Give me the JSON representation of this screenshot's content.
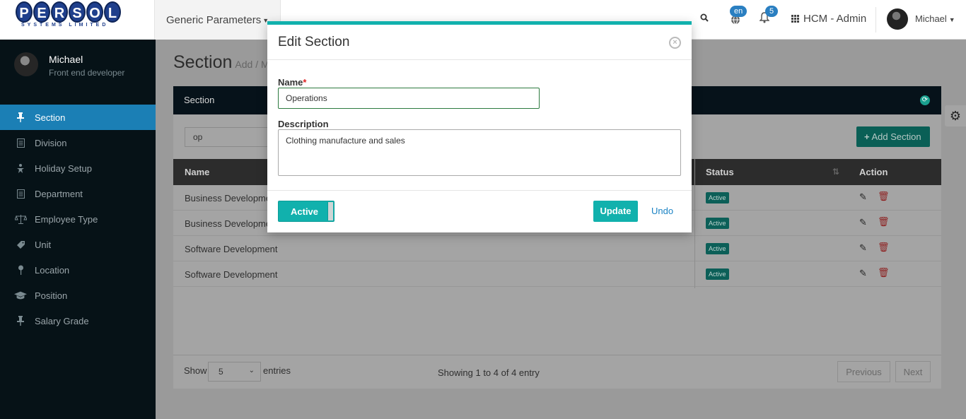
{
  "header": {
    "logo_text": "PERSOL",
    "logo_subtext": "SYSTEMS LIMITED",
    "menu_label": "Generic Parameters",
    "lang_badge": "en",
    "notif_count": "5",
    "app_label": "HCM - Admin",
    "user_name": "Michael"
  },
  "sidebar": {
    "user_name": "Michael",
    "user_role": "Front end developer",
    "items": [
      {
        "label": "Section",
        "icon": "pin-icon"
      },
      {
        "label": "Division",
        "icon": "document-icon"
      },
      {
        "label": "Holiday Setup",
        "icon": "person-icon"
      },
      {
        "label": "Department",
        "icon": "document-icon"
      },
      {
        "label": "Employee Type",
        "icon": "scale-icon"
      },
      {
        "label": "Unit",
        "icon": "tag-icon"
      },
      {
        "label": "Location",
        "icon": "map-pin-icon"
      },
      {
        "label": "Position",
        "icon": "graduation-cap-icon"
      },
      {
        "label": "Salary Grade",
        "icon": "pin-icon"
      }
    ]
  },
  "page": {
    "title": "Section",
    "subtitle": "Add / M"
  },
  "panel": {
    "title": "Section",
    "search_value": "op",
    "add_button": "Add Section",
    "columns": {
      "name": "Name",
      "status": "Status",
      "action": "Action"
    },
    "rows": [
      {
        "name": "Business Developme",
        "status": "Active"
      },
      {
        "name": "Business Developme",
        "status": "Active"
      },
      {
        "name": "Software Development",
        "status": "Active"
      },
      {
        "name": "Software Development",
        "status": "Active"
      }
    ],
    "footer": {
      "show_label": "Show",
      "page_size": "5",
      "entries_label": "entries",
      "showing_text": "Showing 1 to 4 of 4 entry",
      "prev_label": "Previous",
      "next_label": "Next"
    }
  },
  "modal": {
    "title": "Edit Section",
    "name_label": "Name",
    "required_mark": "*",
    "name_value": "Operations",
    "description_label": "Description",
    "description_value": "Clothing manufacture and sales",
    "toggle_label": "Active",
    "update_label": "Update",
    "undo_label": "Undo"
  },
  "colors": {
    "accent": "#11b1ad",
    "sidebar_bg": "#061217",
    "sidebar_active": "#1b7fb5",
    "link": "#1b83c4",
    "danger": "#d22222"
  }
}
